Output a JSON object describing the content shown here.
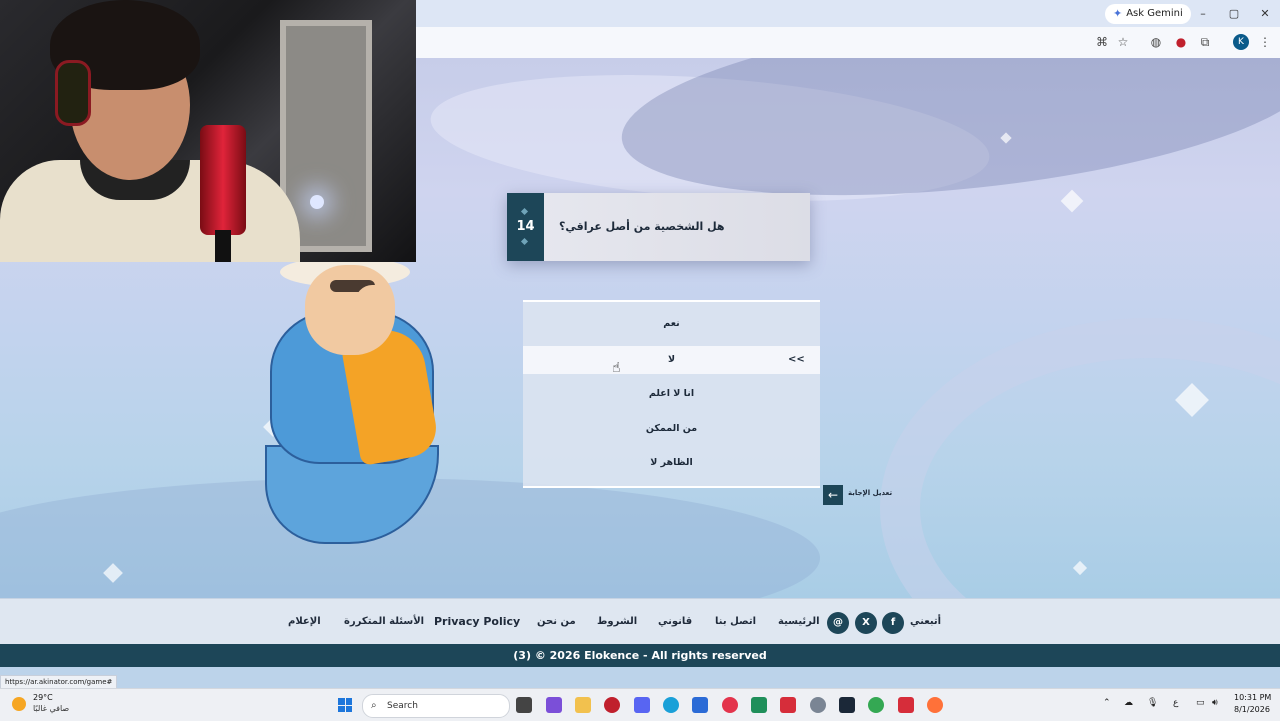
{
  "browser": {
    "gemini_label": "Ask Gemini",
    "profile_initial": "K",
    "window_controls": [
      "–",
      "▢",
      "✕"
    ]
  },
  "game": {
    "question_number": "14",
    "question_text": "هل الشخصية من أصل عراقي؟",
    "answers": [
      "نعم",
      "لا",
      "انا لا اعلم",
      "من الممكن",
      "الظاهر لا"
    ],
    "hover_chevron": "<<",
    "undo_label": "تعديل الإجابة"
  },
  "footer": {
    "follow_label": "أتبعني",
    "nav": [
      "الرئيسية",
      "اتصل بنا",
      "قانوني",
      "الشروط",
      "من نحن",
      "Privacy Policy",
      "الأسئلة المتكررة",
      "الإعلام"
    ],
    "copyright": "(3)  © 2026 Elokence - All rights reserved"
  },
  "status_url": "https://ar.akinator.com/game#",
  "taskbar": {
    "temperature": "29°C",
    "weather": "صافي غالبًا",
    "search_placeholder": "Search",
    "time": "10:31 PM",
    "date": "8/1/2026",
    "lang": "ع"
  },
  "colors": {
    "accent": "#1d4658",
    "windows_blue": "#1d76db"
  }
}
